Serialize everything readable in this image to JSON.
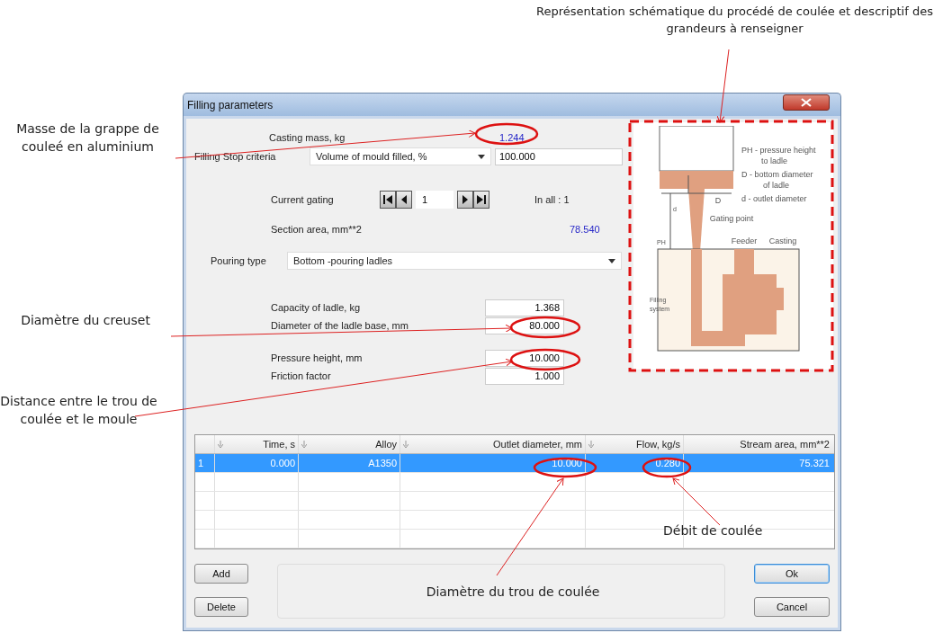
{
  "annotations": [
    {
      "text": "Représentation schématique du procédé de coulée et descriptif des grandeurs à renseigner"
    },
    {
      "text": "Masse de la grappe de couleé en aluminium"
    },
    {
      "text": "Diamètre du creuset"
    },
    {
      "text": "Distance entre le trou de coulée et le moule"
    },
    {
      "text": "Débit de coulée"
    },
    {
      "text": "Diamètre du trou de coulée"
    }
  ],
  "window": {
    "title": "Filling parameters"
  },
  "casting_mass": {
    "label": "Casting mass, kg",
    "value": "1.244"
  },
  "stop_criteria": {
    "label": "Filling Stop criteria",
    "option": "Volume of mould filled, %",
    "value": "100.000"
  },
  "gating": {
    "label": "Current gating",
    "value": "1",
    "total": "In all : 1"
  },
  "section_area": {
    "label": "Section area, mm**2",
    "value": "78.540"
  },
  "pouring_type": {
    "label": "Pouring type",
    "value": "Bottom -pouring ladles"
  },
  "ladle_fields": [
    {
      "label": "Capacity of ladle, kg",
      "value": "1.368"
    },
    {
      "label": "Diameter of the ladle base, mm",
      "value": "80.000"
    }
  ],
  "pressure_fields": [
    {
      "label": "Pressure height, mm",
      "value": "10.000"
    },
    {
      "label": "Friction factor",
      "value": "1.000"
    }
  ],
  "diagram": {
    "labels": [
      "PH - pressure height",
      "to ladle",
      "D - bottom diameter",
      "of ladle",
      "d -  outlet diameter",
      "d",
      "D",
      "PH",
      "Gating point",
      "Feeder",
      "Casting",
      "Filling",
      "system"
    ]
  },
  "table": {
    "columns": [
      "Time, s",
      "Alloy",
      "Outlet diameter, mm",
      "Flow, kg/s",
      "Stream area, mm**2"
    ],
    "rows": [
      {
        "index": "1",
        "cells": [
          "0.000",
          "A1350",
          "10.000",
          "0.280",
          "75.321"
        ],
        "selected": true
      }
    ]
  },
  "buttons": {
    "left": [
      "Add",
      "Delete"
    ],
    "right": [
      "Ok",
      "Cancel"
    ]
  }
}
